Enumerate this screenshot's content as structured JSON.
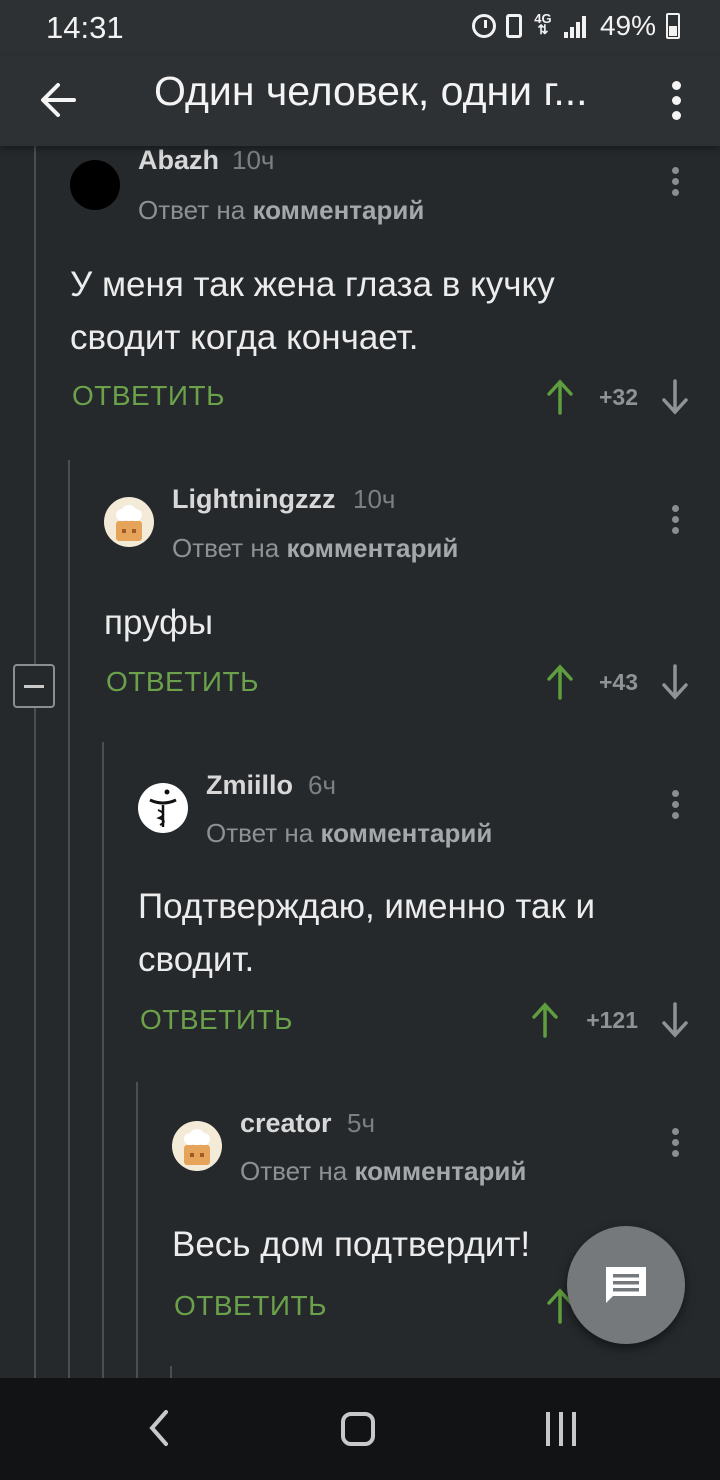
{
  "status_bar": {
    "time": "14:31",
    "network": "4G",
    "battery": "49%"
  },
  "app_bar": {
    "title": "Один человек, одни г..."
  },
  "comments": [
    {
      "author": "Abazh",
      "time": "10ч",
      "reply_prefix": "Ответ на",
      "reply_target": "комментарий",
      "body_lines": [
        "У меня так жена глаза в кучку",
        "сводит когда кончает."
      ],
      "reply_label": "ОТВЕТИТЬ",
      "rating": "+32",
      "avatar": "black-circle"
    },
    {
      "author": "Lightningzzz",
      "time": "10ч",
      "reply_prefix": "Ответ на",
      "reply_target": "комментарий",
      "body_lines": [
        "пруфы"
      ],
      "reply_label": "ОТВЕТИТЬ",
      "rating": "+43",
      "avatar": "chef-default"
    },
    {
      "author": "Zmiillo",
      "time": "6ч",
      "reply_prefix": "Ответ на",
      "reply_target": "комментарий",
      "body_lines": [
        "Подтверждаю, именно так и",
        "сводит."
      ],
      "reply_label": "ОТВЕТИТЬ",
      "rating": "+121",
      "avatar": "pharmacy-symbol"
    },
    {
      "author": "creator",
      "time": "5ч",
      "reply_prefix": "Ответ на",
      "reply_target": "комментарий",
      "body_lines": [
        "Весь дом подтвердит!"
      ],
      "reply_label": "ОТВЕТИТЬ",
      "rating": "",
      "avatar": "chef-default"
    }
  ],
  "colors": {
    "background": "#25292c",
    "accent_green": "#6aa14a",
    "upvote_green": "#5f9e3e"
  }
}
